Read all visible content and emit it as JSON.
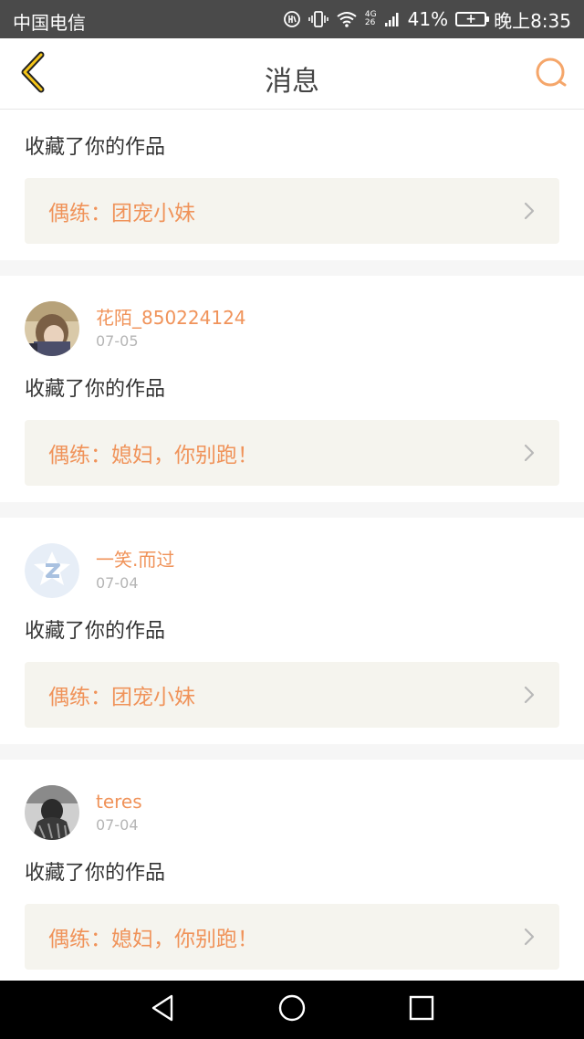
{
  "status_bar": {
    "carrier": "中国电信",
    "network_top": "4G",
    "network_bottom": "26",
    "battery": "41%",
    "time": "晚上8:35"
  },
  "header": {
    "title": "消息",
    "accent_color": "#f5a623"
  },
  "messages": [
    {
      "action": "收藏了你的作品",
      "work": "偶练：团宠小妹"
    },
    {
      "username": "花陌_850224124",
      "date": "07-05",
      "avatar": "photo-avatar",
      "action": "收藏了你的作品",
      "work": "偶练：媳妇，你别跑！"
    },
    {
      "username": "一笑.而过",
      "date": "07-04",
      "avatar": "default-qzone-avatar",
      "action": "收藏了你的作品",
      "work": "偶练：团宠小妹"
    },
    {
      "username": "teres",
      "date": "07-04",
      "avatar": "photo-avatar-dark",
      "action": "收藏了你的作品",
      "work": "偶练：媳妇，你别跑！"
    }
  ],
  "colors": {
    "username": "#f0935a",
    "work_text": "#f0935a",
    "work_bg": "#f5f4ee",
    "status_bar_bg": "#4a4a4a"
  }
}
